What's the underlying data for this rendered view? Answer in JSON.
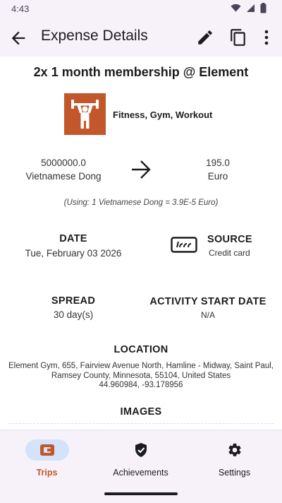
{
  "status": {
    "time": "4:43"
  },
  "header": {
    "title": "Expense Details"
  },
  "expense": {
    "title": "2x 1 month membership @ Element",
    "category_label": "Fitness, Gym, Workout",
    "category_icon": "weightlifting-icon",
    "category_color": "#c1572a"
  },
  "conversion": {
    "from_amount": "5000000.0",
    "from_currency": "Vietnamese Dong",
    "to_amount": "195.0",
    "to_currency": "Euro",
    "rate_note": "(Using: 1 Vietnamese Dong = 3.9E-5 Euro)"
  },
  "date": {
    "label": "DATE",
    "value": "Tue, February 03 2026"
  },
  "source": {
    "label": "SOURCE",
    "value": "Credit card"
  },
  "spread": {
    "label": "SPREAD",
    "value": "30 day(s)"
  },
  "activity_start": {
    "label": "ACTIVITY START DATE",
    "value": "N/A"
  },
  "location": {
    "label": "LOCATION",
    "line1": "Element Gym, 655, Fairview Avenue North, Hamline - Midway, Saint Paul,",
    "line2": "Ramsey County, Minnesota, 55104, United States",
    "line3": "44.960984, -93.178956"
  },
  "images": {
    "label": "IMAGES"
  },
  "nav": {
    "items": [
      {
        "label": "Trips",
        "icon": "wallet-icon",
        "active": true
      },
      {
        "label": "Achievements",
        "icon": "badge-check-icon",
        "active": false
      },
      {
        "label": "Settings",
        "icon": "gear-icon",
        "active": false
      }
    ]
  },
  "colors": {
    "accent": "#c1572a",
    "bar_bg": "#f7f2fa",
    "active_pill": "#d3e3fb"
  }
}
